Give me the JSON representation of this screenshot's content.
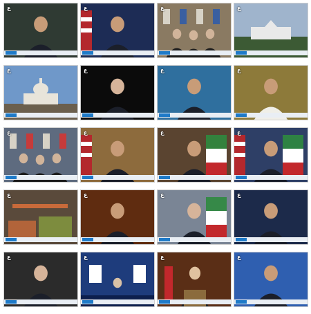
{
  "logo_text": "ع",
  "colors": {
    "ticker_bg": "#e9eef4",
    "ticker_tag": "#1e7ac8",
    "border": "#cfcfcf"
  },
  "thumbnails": [
    {
      "scene": "parliament-speaker",
      "ticker": "",
      "bg": "#2f3a33",
      "accent": "#c9c4b3"
    },
    {
      "scene": "white-house-briefing",
      "ticker": "",
      "bg": "#1d2c55",
      "accent": "#b3282d"
    },
    {
      "scene": "negotiation-table",
      "ticker": "",
      "bg": "#8a7a62",
      "accent": "#3a5fa0"
    },
    {
      "scene": "white-house-exterior",
      "ticker": "",
      "bg": "#9fb4cc",
      "accent": "#e9e9e9"
    },
    {
      "scene": "capitol-building",
      "ticker": "",
      "bg": "#6f98c9",
      "accent": "#e8e4da"
    },
    {
      "scene": "interview-grey-hair",
      "ticker": "",
      "bg": "#0b0b0b",
      "accent": "#d6b49a"
    },
    {
      "scene": "two-speakers-panel",
      "ticker": "",
      "bg": "#2f6f9e",
      "accent": "#6b6b6b"
    },
    {
      "scene": "omani-leader",
      "ticker": "",
      "bg": "#8d7a3a",
      "accent": "#f0efe8"
    },
    {
      "scene": "diplomats-walking",
      "ticker": "",
      "bg": "#5e6b7f",
      "accent": "#c63b3a"
    },
    {
      "scene": "obama-speaking",
      "ticker": "",
      "bg": "#8d6b3d",
      "accent": "#d2a56b"
    },
    {
      "scene": "iran-official-flag",
      "ticker": "",
      "bg": "#5a4430",
      "accent": "#2f8a3f"
    },
    {
      "scene": "obama-with-flag",
      "ticker": "",
      "bg": "#2e3f66",
      "accent": "#b8312f"
    },
    {
      "scene": "shipping-containers",
      "ticker": "",
      "bg": "#5a4a3b",
      "accent": "#b2643a"
    },
    {
      "scene": "analyst-glasses",
      "ticker": "",
      "bg": "#5f2c10",
      "accent": "#d08a4a"
    },
    {
      "scene": "grey-haired-official",
      "ticker": "",
      "bg": "#7a8595",
      "accent": "#d8d8d8"
    },
    {
      "scene": "blonde-spokesperson",
      "ticker": "",
      "bg": "#1c2a4a",
      "accent": "#e7cfa6"
    },
    {
      "scene": "zarif-interview",
      "ticker": "",
      "bg": "#2b2b2b",
      "accent": "#e4c9a7"
    },
    {
      "scene": "stage-with-portraits",
      "ticker": "",
      "bg": "#1e3c7c",
      "accent": "#ffffff"
    },
    {
      "scene": "rouhani-podium",
      "ticker": "",
      "bg": "#5a2e16",
      "accent": "#ffffff"
    },
    {
      "scene": "khamenei-speaking",
      "ticker": "",
      "bg": "#2f5fb0",
      "accent": "#1a1a1a"
    }
  ]
}
